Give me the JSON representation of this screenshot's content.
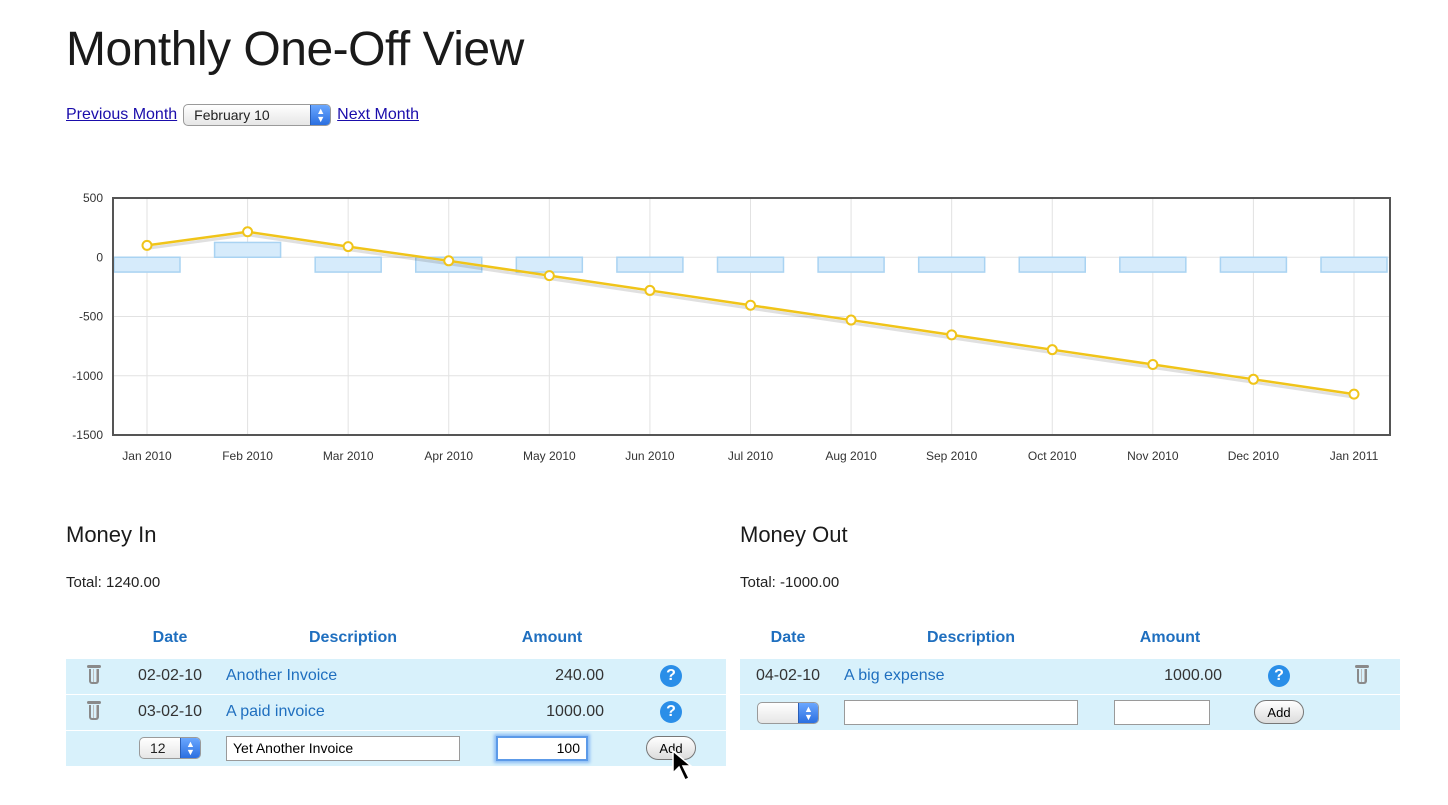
{
  "page": {
    "title": "Monthly One-Off View"
  },
  "nav": {
    "previous_label": "Previous Month",
    "month_select": "February 10",
    "next_label": "Next Month"
  },
  "chart_data": {
    "type": "bar+line",
    "y_ticks": [
      "500",
      "0",
      "-500",
      "-1000",
      "-1500"
    ],
    "ylim": [
      -1500,
      500
    ],
    "categories": [
      "Jan 2010",
      "Feb 2010",
      "Mar 2010",
      "Apr 2010",
      "May 2010",
      "Jun 2010",
      "Jul 2010",
      "Aug 2010",
      "Sep 2010",
      "Oct 2010",
      "Nov 2010",
      "Dec 2010",
      "Jan 2011"
    ],
    "series": [
      {
        "type": "bar",
        "values": [
          -125,
          125,
          -125,
          -125,
          -125,
          -125,
          -125,
          -125,
          -125,
          -125,
          -125,
          -125,
          -125
        ],
        "color": "#d6ebfb"
      },
      {
        "type": "line",
        "values": [
          100,
          215,
          90,
          -30,
          -155,
          -280,
          -405,
          -530,
          -655,
          -780,
          -905,
          -1030,
          -1155
        ],
        "color": "#f0c419"
      }
    ],
    "grid": true
  },
  "money_in": {
    "title": "Money In",
    "total": "Total: 1240.00",
    "headers": [
      "Date",
      "Description",
      "Amount"
    ],
    "rows": [
      {
        "date": "02-02-10",
        "description": "Another Invoice",
        "amount": "240.00"
      },
      {
        "date": "03-02-10",
        "description": "A paid invoice",
        "amount": "1000.00"
      }
    ],
    "new_row": {
      "day": "12",
      "description": "Yet Another Invoice",
      "amount": "100",
      "add_label": "Add"
    }
  },
  "money_out": {
    "title": "Money Out",
    "total": "Total: -1000.00",
    "headers": [
      "Date",
      "Description",
      "Amount"
    ],
    "rows": [
      {
        "date": "04-02-10",
        "description": "A big expense",
        "amount": "1000.00"
      }
    ],
    "new_row": {
      "day": "",
      "description": "",
      "amount": "",
      "add_label": "Add"
    }
  },
  "icons": {
    "help": "?",
    "select_arrows": "▲▼"
  }
}
